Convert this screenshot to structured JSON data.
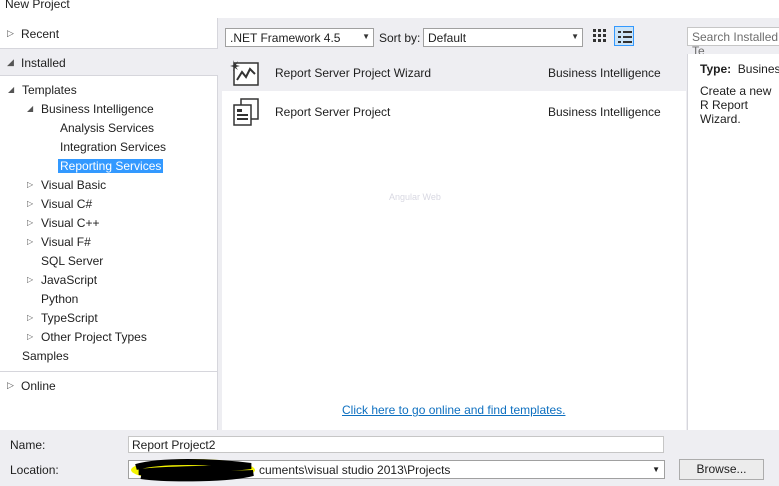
{
  "window": {
    "title": "New Project"
  },
  "sidebar": {
    "recent": "Recent",
    "installed": "Installed",
    "online": "Online",
    "tree": [
      {
        "label": "Templates",
        "arrow": "◢",
        "level": 0,
        "selected": false
      },
      {
        "label": "Business Intelligence",
        "arrow": "◢",
        "level": 1,
        "selected": false
      },
      {
        "label": "Analysis Services",
        "arrow": "",
        "level": 2,
        "selected": false
      },
      {
        "label": "Integration Services",
        "arrow": "",
        "level": 2,
        "selected": false
      },
      {
        "label": "Reporting Services",
        "arrow": "",
        "level": 2,
        "selected": true
      },
      {
        "label": "Visual Basic",
        "arrow": "▷",
        "level": 1,
        "selected": false
      },
      {
        "label": "Visual C#",
        "arrow": "▷",
        "level": 1,
        "selected": false
      },
      {
        "label": "Visual C++",
        "arrow": "▷",
        "level": 1,
        "selected": false
      },
      {
        "label": "Visual F#",
        "arrow": "▷",
        "level": 1,
        "selected": false
      },
      {
        "label": "SQL Server",
        "arrow": "",
        "level": 1,
        "selected": false
      },
      {
        "label": "JavaScript",
        "arrow": "▷",
        "level": 1,
        "selected": false
      },
      {
        "label": "Python",
        "arrow": "",
        "level": 1,
        "selected": false
      },
      {
        "label": "TypeScript",
        "arrow": "▷",
        "level": 1,
        "selected": false
      },
      {
        "label": "Other Project Types",
        "arrow": "▷",
        "level": 1,
        "selected": false
      },
      {
        "label": "Samples",
        "arrow": "",
        "level": 0,
        "selected": false
      }
    ]
  },
  "toolbar": {
    "framework": ".NET Framework 4.5",
    "sort_label": "Sort by:",
    "sort_value": "Default",
    "search_placeholder": "Search Installed Te"
  },
  "templates": [
    {
      "name": "Report Server Project Wizard",
      "category": "Business Intelligence",
      "icon": "report-wizard-icon",
      "selected": true
    },
    {
      "name": "Report Server Project",
      "category": "Business Intelligence",
      "icon": "report-project-icon",
      "selected": false
    }
  ],
  "ghost_text": "Angular Web",
  "online_link": "Click here to go online and find templates.",
  "details": {
    "type_label": "Type:",
    "type_value": "Business",
    "description": "Create a new R Report Wizard."
  },
  "form": {
    "name_label": "Name:",
    "name_value": "Report Project2",
    "location_label": "Location:",
    "location_value": "cuments\\visual studio 2013\\Projects",
    "browse_label": "Browse..."
  },
  "colors": {
    "selection": "#3399ff",
    "link": "#0e70c0",
    "highlight": "#ffff00"
  }
}
